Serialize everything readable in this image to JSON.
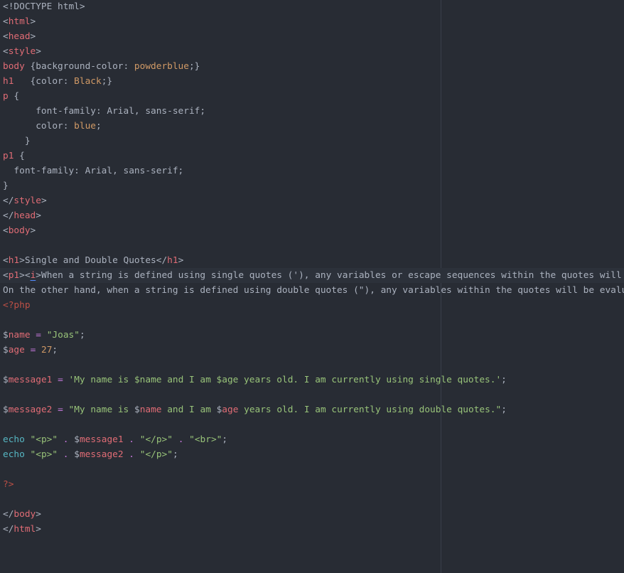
{
  "colors": {
    "background": "#282c34",
    "text": "#abb2bf",
    "tag": "#e06c75",
    "number": "#d19a66",
    "string": "#98c379",
    "operator": "#c678dd",
    "function": "#56b6c2",
    "php": "#be5046"
  },
  "current_line": 17,
  "lines": [
    [
      [
        "<!DOCTYPE html>",
        "plain"
      ]
    ],
    [
      [
        "<",
        "plain"
      ],
      [
        "html",
        "tag"
      ],
      [
        ">",
        "plain"
      ]
    ],
    [
      [
        "<",
        "plain"
      ],
      [
        "head",
        "tag"
      ],
      [
        ">",
        "plain"
      ]
    ],
    [
      [
        "<",
        "plain"
      ],
      [
        "style",
        "tag"
      ],
      [
        ">",
        "plain"
      ]
    ],
    [
      [
        "body",
        "tag"
      ],
      [
        " {background-color: ",
        "plain"
      ],
      [
        "powderblue",
        "num"
      ],
      [
        ";}",
        "plain"
      ]
    ],
    [
      [
        "h1",
        "tag"
      ],
      [
        "   {color: ",
        "plain"
      ],
      [
        "Black",
        "num"
      ],
      [
        ";}",
        "plain"
      ]
    ],
    [
      [
        "p",
        "tag"
      ],
      [
        " {",
        "plain"
      ]
    ],
    [
      [
        "      font-family: Arial, sans-serif;",
        "plain"
      ]
    ],
    [
      [
        "      color: ",
        "plain"
      ],
      [
        "blue",
        "num"
      ],
      [
        ";",
        "plain"
      ]
    ],
    [
      [
        "    }",
        "plain"
      ]
    ],
    [
      [
        "p1",
        "tag"
      ],
      [
        " {",
        "plain"
      ]
    ],
    [
      [
        "  font-family: Arial, sans-serif;",
        "plain"
      ]
    ],
    [
      [
        "}",
        "plain"
      ]
    ],
    [
      [
        "</",
        "plain"
      ],
      [
        "style",
        "tag"
      ],
      [
        ">",
        "plain"
      ]
    ],
    [
      [
        "</",
        "plain"
      ],
      [
        "head",
        "tag"
      ],
      [
        ">",
        "plain"
      ]
    ],
    [
      [
        "<",
        "plain"
      ],
      [
        "body",
        "tag"
      ],
      [
        ">",
        "plain"
      ]
    ],
    [],
    [
      [
        "<",
        "plain"
      ],
      [
        "h1",
        "tag"
      ],
      [
        ">Single and Double Quotes</",
        "plain"
      ],
      [
        "h1",
        "tag"
      ],
      [
        ">",
        "plain"
      ]
    ],
    [
      [
        "<",
        "plain"
      ],
      [
        "p1",
        "tag"
      ],
      [
        "><",
        "plain"
      ],
      [
        "i",
        "tag cursor"
      ],
      [
        ">When a string is defined using single quotes ('), any variables or escape sequences within the quotes will",
        "plain"
      ]
    ],
    [
      [
        "On the other hand, when a string is defined using double quotes (\"), any variables within the quotes will be evalu",
        "plain"
      ]
    ],
    [
      [
        "<?php",
        "php"
      ]
    ],
    [],
    [
      [
        "$",
        "plain"
      ],
      [
        "name",
        "var"
      ],
      [
        " ",
        "plain"
      ],
      [
        "=",
        "kw"
      ],
      [
        " ",
        "plain"
      ],
      [
        "\"Joas\"",
        "str"
      ],
      [
        ";",
        "plain"
      ]
    ],
    [
      [
        "$",
        "plain"
      ],
      [
        "age",
        "var"
      ],
      [
        " ",
        "plain"
      ],
      [
        "=",
        "kw"
      ],
      [
        " ",
        "plain"
      ],
      [
        "27",
        "num"
      ],
      [
        ";",
        "plain"
      ]
    ],
    [],
    [
      [
        "$",
        "plain"
      ],
      [
        "message1",
        "var"
      ],
      [
        " ",
        "plain"
      ],
      [
        "=",
        "kw"
      ],
      [
        " ",
        "plain"
      ],
      [
        "'My name is $name and I am $age years old. I am currently using single quotes.'",
        "str"
      ],
      [
        ";",
        "plain"
      ]
    ],
    [],
    [
      [
        "$",
        "plain"
      ],
      [
        "message2",
        "var"
      ],
      [
        " ",
        "plain"
      ],
      [
        "=",
        "kw"
      ],
      [
        " ",
        "plain"
      ],
      [
        "\"My name is ",
        "str"
      ],
      [
        "$",
        "plain"
      ],
      [
        "name",
        "var"
      ],
      [
        " and I am ",
        "str"
      ],
      [
        "$",
        "plain"
      ],
      [
        "age",
        "var"
      ],
      [
        " years old. I am currently using double quotes.\"",
        "str"
      ],
      [
        ";",
        "plain"
      ]
    ],
    [],
    [
      [
        "echo",
        "fn"
      ],
      [
        " ",
        "plain"
      ],
      [
        "\"<p>\"",
        "str"
      ],
      [
        " ",
        "plain"
      ],
      [
        ".",
        "kw"
      ],
      [
        " $",
        "plain"
      ],
      [
        "message1",
        "var"
      ],
      [
        " ",
        "plain"
      ],
      [
        ".",
        "kw"
      ],
      [
        " ",
        "plain"
      ],
      [
        "\"</p>\"",
        "str"
      ],
      [
        " ",
        "plain"
      ],
      [
        ".",
        "kw"
      ],
      [
        " ",
        "plain"
      ],
      [
        "\"<br>\"",
        "str"
      ],
      [
        ";",
        "plain"
      ]
    ],
    [
      [
        "echo",
        "fn"
      ],
      [
        " ",
        "plain"
      ],
      [
        "\"<p>\"",
        "str"
      ],
      [
        " ",
        "plain"
      ],
      [
        ".",
        "kw"
      ],
      [
        " $",
        "plain"
      ],
      [
        "message2",
        "var"
      ],
      [
        " ",
        "plain"
      ],
      [
        ".",
        "kw"
      ],
      [
        " ",
        "plain"
      ],
      [
        "\"</p>\"",
        "str"
      ],
      [
        ";",
        "plain"
      ]
    ],
    [],
    [
      [
        "?>",
        "php"
      ]
    ],
    [],
    [
      [
        "</",
        "plain"
      ],
      [
        "body",
        "tag"
      ],
      [
        ">",
        "plain"
      ]
    ],
    [
      [
        "</",
        "plain"
      ],
      [
        "html",
        "tag"
      ],
      [
        ">",
        "plain"
      ]
    ]
  ]
}
